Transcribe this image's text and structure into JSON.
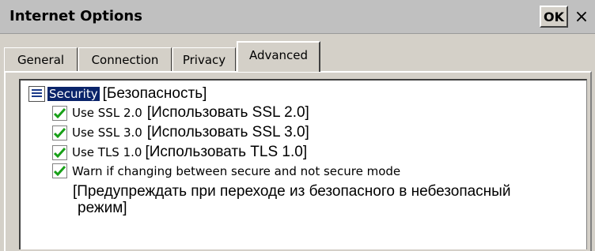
{
  "window": {
    "title": "Internet Options",
    "ok_label": "OK",
    "close_label": "×"
  },
  "tabs": [
    {
      "label": "General",
      "active": false
    },
    {
      "label": "Connection",
      "active": false
    },
    {
      "label": "Privacy",
      "active": false
    },
    {
      "label": "Advanced",
      "active": true
    }
  ],
  "category": {
    "icon": "list-category-icon",
    "label": "Security",
    "annotation": "[Безопасность]"
  },
  "options": [
    {
      "label": "Use SSL 2.0",
      "annotation": "[Использовать SSL 2.0]",
      "checked": true
    },
    {
      "label": "Use SSL 3.0",
      "annotation": "[Использовать SSL 3.0]",
      "checked": true
    },
    {
      "label": "Use TLS 1.0",
      "annotation": "[Использовать TLS 1.0]",
      "checked": true
    },
    {
      "label": "Warn if changing between secure and not secure mode",
      "annotation_line1": "[Предупреждать при переходе из безопасного в небезопасный",
      "annotation_line2": "режим]",
      "checked": true
    }
  ],
  "colors": {
    "checkmark": "#18a018",
    "selection": "#0a246a",
    "chrome": "#d4d0c8"
  }
}
